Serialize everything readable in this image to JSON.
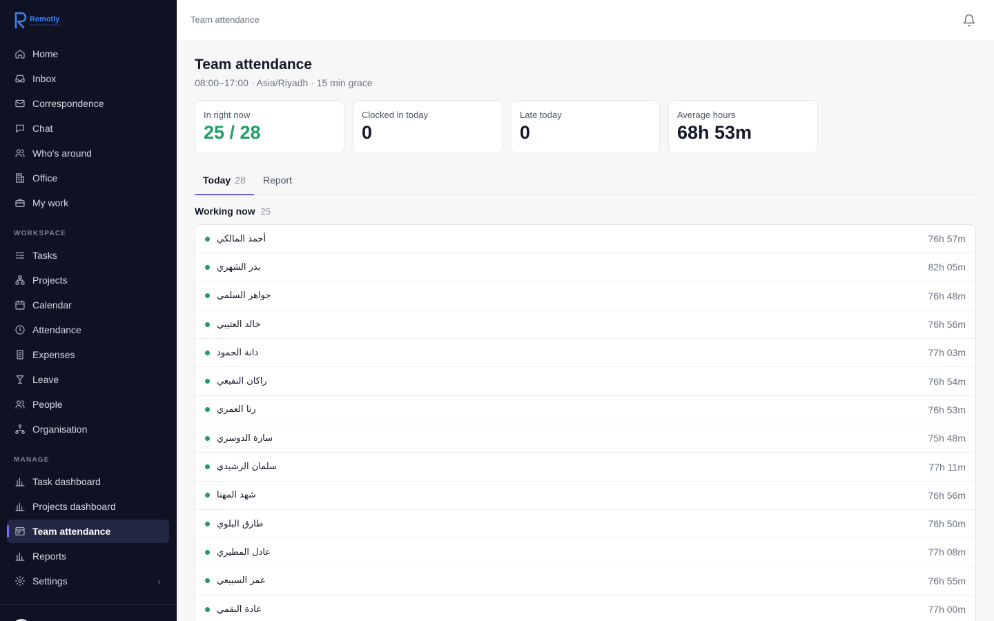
{
  "brand": {
    "name": "Remotly",
    "tagline": "Remote Work For Companies"
  },
  "nav": {
    "main": [
      {
        "label": "Home",
        "icon": "home-icon"
      },
      {
        "label": "Inbox",
        "icon": "inbox-icon"
      },
      {
        "label": "Correspondence",
        "icon": "mail-icon"
      },
      {
        "label": "Chat",
        "icon": "chat-icon"
      },
      {
        "label": "Who's around",
        "icon": "users-icon"
      },
      {
        "label": "Office",
        "icon": "building-icon"
      },
      {
        "label": "My work",
        "icon": "briefcase-icon"
      }
    ],
    "workspace_label": "WORKSPACE",
    "workspace": [
      {
        "label": "Tasks",
        "icon": "tasks-icon"
      },
      {
        "label": "Projects",
        "icon": "projects-icon"
      },
      {
        "label": "Calendar",
        "icon": "calendar-icon"
      },
      {
        "label": "Attendance",
        "icon": "clock-icon"
      },
      {
        "label": "Expenses",
        "icon": "receipt-icon"
      },
      {
        "label": "Leave",
        "icon": "cocktail-icon"
      },
      {
        "label": "People",
        "icon": "people-icon"
      },
      {
        "label": "Organisation",
        "icon": "org-icon"
      }
    ],
    "manage_label": "MANAGE",
    "manage": [
      {
        "label": "Task dashboard",
        "icon": "bar-chart-icon"
      },
      {
        "label": "Projects dashboard",
        "icon": "bar-chart-icon"
      },
      {
        "label": "Team attendance",
        "icon": "attendance-icon",
        "active": true
      },
      {
        "label": "Reports",
        "icon": "bar-chart-icon"
      },
      {
        "label": "Settings",
        "icon": "gear-icon"
      }
    ]
  },
  "header": {
    "breadcrumb": "Team attendance"
  },
  "page": {
    "title": "Team attendance",
    "subtitle": "08:00–17:00 · Asia/Riyadh · 15 min grace"
  },
  "stats": [
    {
      "label": "In right now",
      "value": "25 / 28"
    },
    {
      "label": "Clocked in today",
      "value": "0"
    },
    {
      "label": "Late today",
      "value": "0"
    },
    {
      "label": "Average hours",
      "value": "68h 53m"
    }
  ],
  "tabs": [
    {
      "label": "Today",
      "count": "28"
    },
    {
      "label": "Report",
      "count": ""
    }
  ],
  "working_now": {
    "title": "Working now",
    "count": "25",
    "rows": [
      {
        "name": "أحمد المالكي",
        "hours": "76h 57m"
      },
      {
        "name": "بدر الشهري",
        "hours": "82h 05m"
      },
      {
        "name": "جواهر السلمي",
        "hours": "76h 48m"
      },
      {
        "name": "خالد العتيبي",
        "hours": "76h 56m"
      },
      {
        "name": "دانة الحمود",
        "hours": "77h 03m"
      },
      {
        "name": "راكان النفيعي",
        "hours": "76h 54m"
      },
      {
        "name": "رنا العمري",
        "hours": "76h 53m"
      },
      {
        "name": "سارة الدوسري",
        "hours": "75h 48m"
      },
      {
        "name": "سلمان الرشيدي",
        "hours": "77h 11m"
      },
      {
        "name": "شهد المهنا",
        "hours": "76h 56m"
      },
      {
        "name": "طارق البلوي",
        "hours": "76h 50m"
      },
      {
        "name": "عادل المطيري",
        "hours": "77h 08m"
      },
      {
        "name": "عمر السبيعي",
        "hours": "76h 55m"
      },
      {
        "name": "غادة البقمي",
        "hours": "77h 00m"
      }
    ]
  },
  "colors": {
    "sidebar": "#0f1222",
    "accent": "#6d5fe8",
    "online": "#1e9e62"
  }
}
